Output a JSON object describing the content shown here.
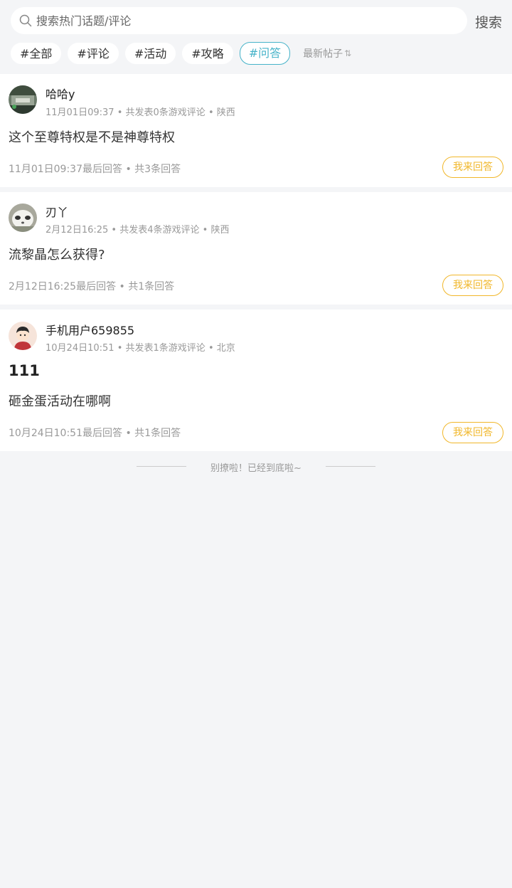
{
  "search": {
    "placeholder": "搜索热门话题/评论",
    "button_label": "搜索"
  },
  "tags": [
    {
      "label": "#全部",
      "active": false
    },
    {
      "label": "#评论",
      "active": false
    },
    {
      "label": "#活动",
      "active": false
    },
    {
      "label": "#攻略",
      "active": false
    },
    {
      "label": "#问答",
      "active": true
    }
  ],
  "sort": {
    "label": "最新帖子",
    "icon": "sort-arrows-icon"
  },
  "posts": [
    {
      "username": "哈哈y",
      "time": "11月01日09:37",
      "stats": "共发表0条游戏评论",
      "location": "陕西",
      "title": "",
      "content": "这个至尊特权是不是神尊特权",
      "last_reply": "11月01日09:37最后回答",
      "reply_count": "共3条回答",
      "answer_label": "我来回答"
    },
    {
      "username": "刃丫",
      "time": "2月12日16:25",
      "stats": "共发表4条游戏评论",
      "location": "陕西",
      "title": "",
      "content": "流黎晶怎么获得?",
      "last_reply": "2月12日16:25最后回答",
      "reply_count": "共1条回答",
      "answer_label": "我来回答"
    },
    {
      "username": "手机用户659855",
      "time": "10月24日10:51",
      "stats": "共发表1条游戏评论",
      "location": "北京",
      "title": "111",
      "content": "砸金蛋活动在哪啊",
      "last_reply": "10月24日10:51最后回答",
      "reply_count": "共1条回答",
      "answer_label": "我来回答"
    }
  ],
  "end_text": "别撩啦！已经到底啦~",
  "colors": {
    "accent": "#46b3c9",
    "answer": "#f1b72a",
    "background": "#f4f5f7"
  }
}
